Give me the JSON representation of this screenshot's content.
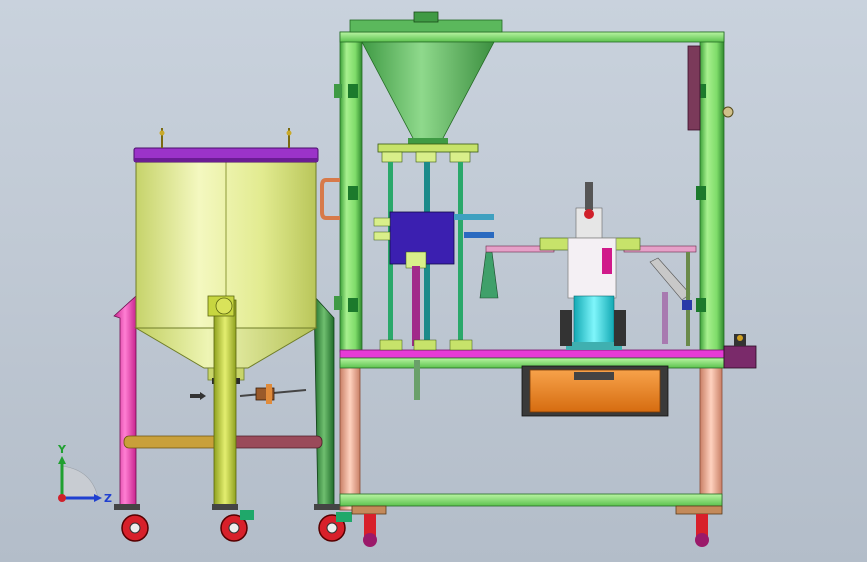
{
  "viewport": {
    "background_top": "#c9d2dd",
    "background_bottom": "#b3bdc9"
  },
  "triad": {
    "y_label": "Y",
    "z_label": "Z",
    "x_axis_color": "#d0202a",
    "y_axis_color": "#20a030",
    "z_axis_color": "#2040d0"
  },
  "colors": {
    "frame_green": "#8ee07a",
    "hopper_green": "#5bb85c",
    "tank_body": "#e6ef9a",
    "tank_lid": "#9b33c9",
    "pink_leg": "#f04ab8",
    "orange_tray": "#f28a1e",
    "cyan_column": "#27e0e8",
    "purple_block": "#3b1fb0",
    "peach_post": "#f2b49a",
    "wheel_red": "#d8202a"
  }
}
